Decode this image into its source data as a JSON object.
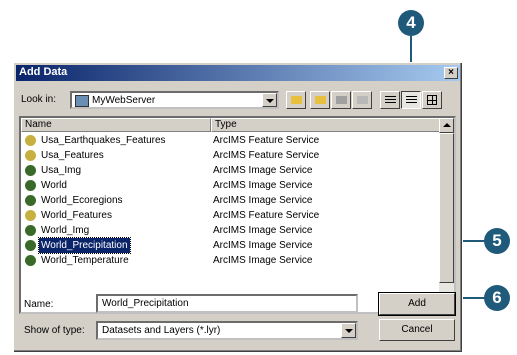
{
  "dialog": {
    "title": "Add Data",
    "look_in_label": "Look in:",
    "look_in_value": "MyWebServer",
    "columns": [
      "Name",
      "Type"
    ],
    "items": [
      {
        "name": "Usa_Earthquakes_Features",
        "type": "ArcIMS Feature Service",
        "icon": "feature-service-icon"
      },
      {
        "name": "Usa_Features",
        "type": "ArcIMS Feature Service",
        "icon": "feature-service-icon"
      },
      {
        "name": "Usa_Img",
        "type": "ArcIMS Image Service",
        "icon": "image-service-icon"
      },
      {
        "name": "World",
        "type": "ArcIMS Image Service",
        "icon": "image-service-icon"
      },
      {
        "name": "World_Ecoregions",
        "type": "ArcIMS Image Service",
        "icon": "image-service-icon"
      },
      {
        "name": "World_Features",
        "type": "ArcIMS Feature Service",
        "icon": "feature-service-icon"
      },
      {
        "name": "World_Img",
        "type": "ArcIMS Image Service",
        "icon": "image-service-icon"
      },
      {
        "name": "World_Precipitation",
        "type": "ArcIMS Image Service",
        "icon": "image-service-icon",
        "selected": true
      },
      {
        "name": "World_Temperature",
        "type": "ArcIMS Image Service",
        "icon": "image-service-icon"
      }
    ],
    "name_label": "Name:",
    "name_value": "World_Precipitation",
    "show_type_label": "Show of type:",
    "show_type_value": "Datasets and Layers (*.lyr)",
    "add_button": "Add",
    "cancel_button": "Cancel",
    "close_glyph": "×"
  },
  "callouts": {
    "c4": "4",
    "c5": "5",
    "c6": "6"
  },
  "colors": {
    "callout": "#1f5a7a",
    "selection": "#0a246a"
  }
}
